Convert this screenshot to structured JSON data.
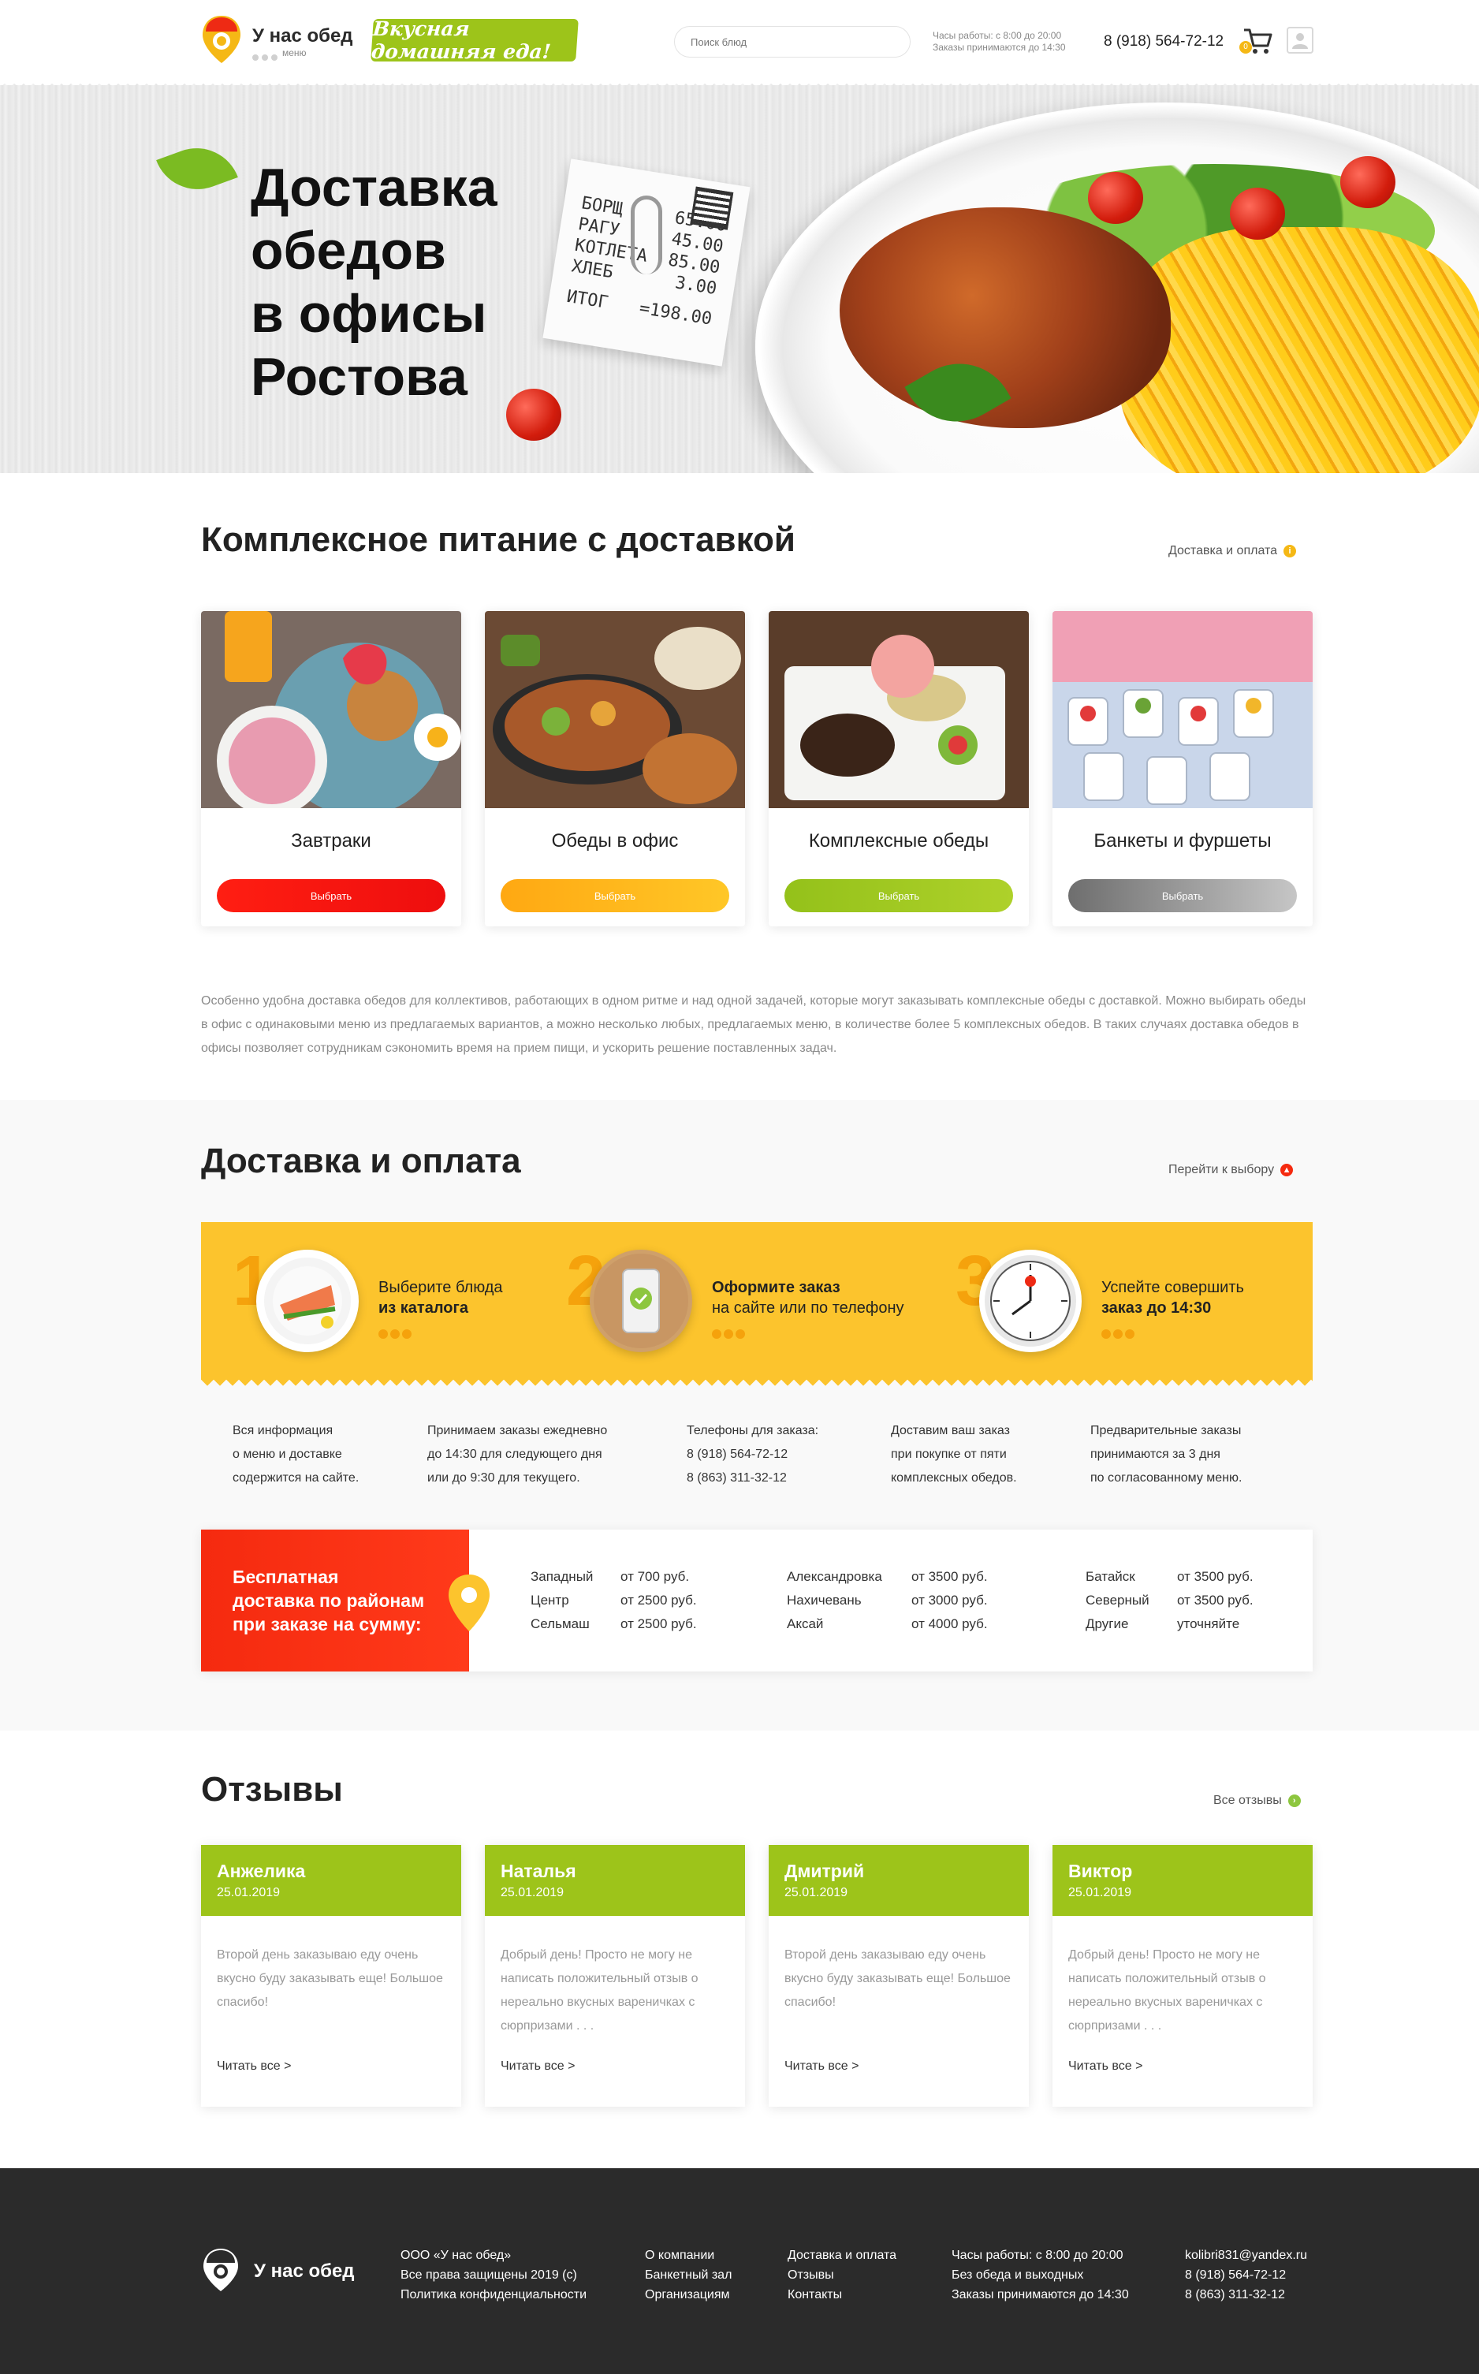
{
  "header": {
    "logo_title": "У нас обед",
    "logo_sub": "меню",
    "slogan": "Вкусная домашняя еда!",
    "search_placeholder": "Поиск блюд",
    "hours_line1": "Часы работы: с 8:00 до 20:00",
    "hours_line2": "Заказы принимаются до 14:30",
    "phone": "8 (918) 564-72-12",
    "cart_count": "0"
  },
  "hero": {
    "title_line1": "Доставка",
    "title_line2": "обедов",
    "title_line3": "в офисы",
    "title_line4": "Ростова",
    "receipt": [
      {
        "item": "БОРЩ",
        "price": "65.00"
      },
      {
        "item": "РАГУ",
        "price": "45.00"
      },
      {
        "item": "КОТЛЕТА",
        "price": "85.00"
      },
      {
        "item": "ХЛЕБ",
        "price": "3.00"
      }
    ],
    "receipt_total_label": "ИТОГ",
    "receipt_total": "=198.00"
  },
  "complex": {
    "title": "Комплексное питание с доставкой",
    "link": "Доставка и оплата",
    "cards": [
      {
        "name": "Завтраки",
        "button": "Выбрать",
        "color_from": "#ff1e12",
        "color_to": "#ee0e0e"
      },
      {
        "name": "Обеды в офис",
        "button": "Выбрать",
        "color_from": "#ffa812",
        "color_to": "#ffc727"
      },
      {
        "name": "Комплексные обеды",
        "button": "Выбрать",
        "color_from": "#94c11a",
        "color_to": "#aed12a"
      },
      {
        "name": "Банкеты и фуршеты",
        "button": "Выбрать",
        "color_from": "#6e6e6e",
        "color_to": "#c6c6c6"
      }
    ],
    "description": "Особенно удобна доставка обедов для коллективов, работающих в одном ритме и над одной задачей, которые могут заказывать комплексные обеды с доставкой. Можно выбирать обеды в офис с одинаковыми меню из предлагаемых вариантов, а можно несколько любых, предлагаемых меню, в количестве более 5 комплексных обедов. В таких случаях доставка обедов в офисы позволяет сотрудникам сэкономить время на прием пищи, и ускорить решение поставленных задач."
  },
  "delivery": {
    "title": "Доставка и оплата",
    "link": "Перейти к выбору",
    "steps": [
      {
        "num": "1",
        "line1": "Выберите блюда",
        "line2": "из каталога"
      },
      {
        "num": "2",
        "line1": "Оформите заказ",
        "line2": "на сайте или по телефону"
      },
      {
        "num": "3",
        "line1": "Успейте совершить",
        "line2": "заказ до 14:30"
      }
    ],
    "info": [
      [
        "Вся информация",
        "о меню и доставке",
        "содержится на сайте."
      ],
      [
        "Принимаем заказы ежедневно",
        "до 14:30 для следующего дня",
        "или до 9:30 для текущего."
      ],
      [
        "Телефоны для заказа:",
        "8 (918) 564-72-12",
        "8 (863) 311-32-12"
      ],
      [
        "Доставим ваш заказ",
        "при покупке от пяти",
        "комплексных обедов."
      ],
      [
        "Предварительные заказы",
        "принимаются за 3 дня",
        "по согласованному меню."
      ]
    ],
    "free_title_line1": "Бесплатная",
    "free_title_line2": "доставка по районам",
    "free_title_line3": "при заказе на сумму:",
    "zones": [
      [
        {
          "name": "Западный",
          "price": "от 700 руб."
        },
        {
          "name": "Центр",
          "price": "от 2500 руб."
        },
        {
          "name": "Сельмаш",
          "price": "от 2500 руб."
        }
      ],
      [
        {
          "name": "Александровка",
          "price": "от 3500 руб."
        },
        {
          "name": "Нахичевань",
          "price": "от 3000 руб."
        },
        {
          "name": "Аксай",
          "price": "от 4000 руб."
        }
      ],
      [
        {
          "name": "Батайск",
          "price": "от 3500 руб."
        },
        {
          "name": "Северный",
          "price": "от 3500 руб."
        },
        {
          "name": "Другие",
          "price": "уточняйте"
        }
      ]
    ]
  },
  "reviews": {
    "title": "Отзывы",
    "link": "Все отзывы",
    "items": [
      {
        "name": "Анжелика",
        "date": "25.01.2019",
        "text": "Второй день заказываю еду очень вкусно буду заказывать еще! Большое спасибо!",
        "more": "Читать все >"
      },
      {
        "name": "Наталья",
        "date": "25.01.2019",
        "text": "Добрый день! Просто не могу не написать положительный отзыв о нереально вкусных вареничках с сюрпризами . . .",
        "more": "Читать все >"
      },
      {
        "name": "Дмитрий",
        "date": "25.01.2019",
        "text": "Второй день заказываю еду очень вкусно буду заказывать еще! Большое спасибо!",
        "more": "Читать все >"
      },
      {
        "name": "Виктор",
        "date": "25.01.2019",
        "text": "Добрый день! Просто не могу не написать положительный отзыв о нереально вкусных вареничках с сюрпризами . . .",
        "more": "Читать все >"
      }
    ]
  },
  "footer": {
    "logo_title": "У нас обед",
    "legal": [
      "ООО «У нас обед»",
      "Все права защищены 2019 (c)",
      "Политика конфиденциальности"
    ],
    "menu1": [
      "О компании",
      "Банкетный зал",
      "Организациям"
    ],
    "menu2": [
      "Доставка и оплата",
      "Отзывы",
      "Контакты"
    ],
    "hours": [
      "Часы работы: с 8:00 до 20:00",
      "Без обеда и выходных",
      "Заказы принимаются до 14:30"
    ],
    "contacts": [
      "kolibri831@yandex.ru",
      "8 (918) 564-72-12",
      "8 (863) 311-32-12"
    ]
  },
  "colors": {
    "green": "#9dc41a",
    "yellow": "#fcc42d",
    "red": "#f52a0f",
    "orange": "#f5a20c",
    "dark": "#2b2b2b"
  }
}
